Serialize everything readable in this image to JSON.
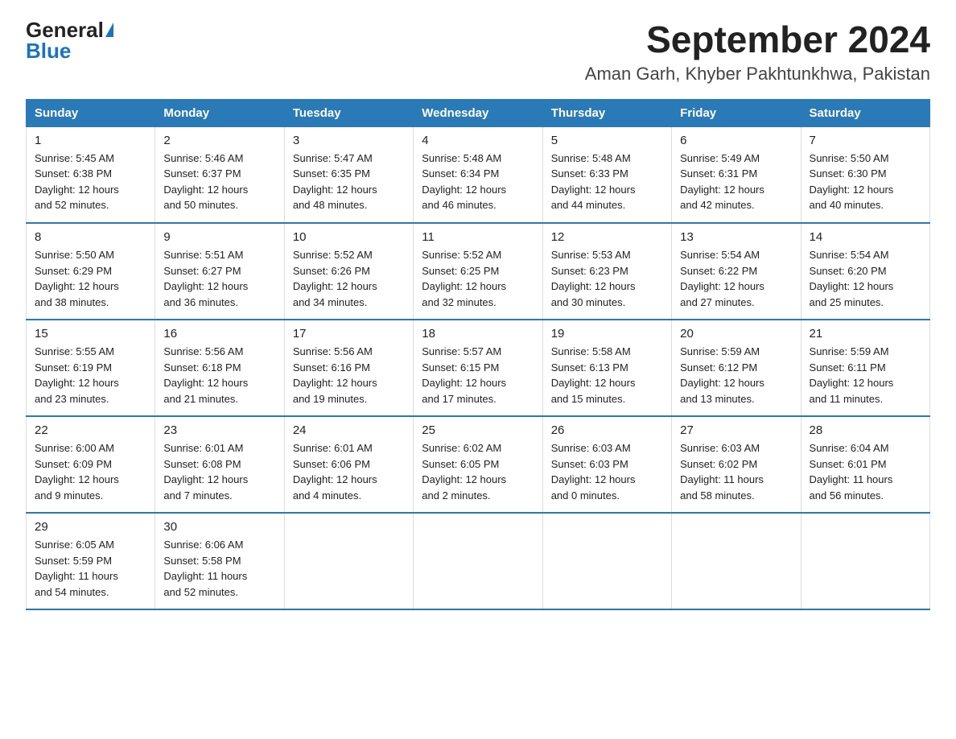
{
  "header": {
    "logo_general": "General",
    "logo_blue": "Blue",
    "title": "September 2024",
    "subtitle": "Aman Garh, Khyber Pakhtunkhwa, Pakistan"
  },
  "days_of_week": [
    "Sunday",
    "Monday",
    "Tuesday",
    "Wednesday",
    "Thursday",
    "Friday",
    "Saturday"
  ],
  "weeks": [
    [
      {
        "day": "1",
        "sunrise": "5:45 AM",
        "sunset": "6:38 PM",
        "daylight": "12 hours and 52 minutes."
      },
      {
        "day": "2",
        "sunrise": "5:46 AM",
        "sunset": "6:37 PM",
        "daylight": "12 hours and 50 minutes."
      },
      {
        "day": "3",
        "sunrise": "5:47 AM",
        "sunset": "6:35 PM",
        "daylight": "12 hours and 48 minutes."
      },
      {
        "day": "4",
        "sunrise": "5:48 AM",
        "sunset": "6:34 PM",
        "daylight": "12 hours and 46 minutes."
      },
      {
        "day": "5",
        "sunrise": "5:48 AM",
        "sunset": "6:33 PM",
        "daylight": "12 hours and 44 minutes."
      },
      {
        "day": "6",
        "sunrise": "5:49 AM",
        "sunset": "6:31 PM",
        "daylight": "12 hours and 42 minutes."
      },
      {
        "day": "7",
        "sunrise": "5:50 AM",
        "sunset": "6:30 PM",
        "daylight": "12 hours and 40 minutes."
      }
    ],
    [
      {
        "day": "8",
        "sunrise": "5:50 AM",
        "sunset": "6:29 PM",
        "daylight": "12 hours and 38 minutes."
      },
      {
        "day": "9",
        "sunrise": "5:51 AM",
        "sunset": "6:27 PM",
        "daylight": "12 hours and 36 minutes."
      },
      {
        "day": "10",
        "sunrise": "5:52 AM",
        "sunset": "6:26 PM",
        "daylight": "12 hours and 34 minutes."
      },
      {
        "day": "11",
        "sunrise": "5:52 AM",
        "sunset": "6:25 PM",
        "daylight": "12 hours and 32 minutes."
      },
      {
        "day": "12",
        "sunrise": "5:53 AM",
        "sunset": "6:23 PM",
        "daylight": "12 hours and 30 minutes."
      },
      {
        "day": "13",
        "sunrise": "5:54 AM",
        "sunset": "6:22 PM",
        "daylight": "12 hours and 27 minutes."
      },
      {
        "day": "14",
        "sunrise": "5:54 AM",
        "sunset": "6:20 PM",
        "daylight": "12 hours and 25 minutes."
      }
    ],
    [
      {
        "day": "15",
        "sunrise": "5:55 AM",
        "sunset": "6:19 PM",
        "daylight": "12 hours and 23 minutes."
      },
      {
        "day": "16",
        "sunrise": "5:56 AM",
        "sunset": "6:18 PM",
        "daylight": "12 hours and 21 minutes."
      },
      {
        "day": "17",
        "sunrise": "5:56 AM",
        "sunset": "6:16 PM",
        "daylight": "12 hours and 19 minutes."
      },
      {
        "day": "18",
        "sunrise": "5:57 AM",
        "sunset": "6:15 PM",
        "daylight": "12 hours and 17 minutes."
      },
      {
        "day": "19",
        "sunrise": "5:58 AM",
        "sunset": "6:13 PM",
        "daylight": "12 hours and 15 minutes."
      },
      {
        "day": "20",
        "sunrise": "5:59 AM",
        "sunset": "6:12 PM",
        "daylight": "12 hours and 13 minutes."
      },
      {
        "day": "21",
        "sunrise": "5:59 AM",
        "sunset": "6:11 PM",
        "daylight": "12 hours and 11 minutes."
      }
    ],
    [
      {
        "day": "22",
        "sunrise": "6:00 AM",
        "sunset": "6:09 PM",
        "daylight": "12 hours and 9 minutes."
      },
      {
        "day": "23",
        "sunrise": "6:01 AM",
        "sunset": "6:08 PM",
        "daylight": "12 hours and 7 minutes."
      },
      {
        "day": "24",
        "sunrise": "6:01 AM",
        "sunset": "6:06 PM",
        "daylight": "12 hours and 4 minutes."
      },
      {
        "day": "25",
        "sunrise": "6:02 AM",
        "sunset": "6:05 PM",
        "daylight": "12 hours and 2 minutes."
      },
      {
        "day": "26",
        "sunrise": "6:03 AM",
        "sunset": "6:03 PM",
        "daylight": "12 hours and 0 minutes."
      },
      {
        "day": "27",
        "sunrise": "6:03 AM",
        "sunset": "6:02 PM",
        "daylight": "11 hours and 58 minutes."
      },
      {
        "day": "28",
        "sunrise": "6:04 AM",
        "sunset": "6:01 PM",
        "daylight": "11 hours and 56 minutes."
      }
    ],
    [
      {
        "day": "29",
        "sunrise": "6:05 AM",
        "sunset": "5:59 PM",
        "daylight": "11 hours and 54 minutes."
      },
      {
        "day": "30",
        "sunrise": "6:06 AM",
        "sunset": "5:58 PM",
        "daylight": "11 hours and 52 minutes."
      },
      null,
      null,
      null,
      null,
      null
    ]
  ]
}
